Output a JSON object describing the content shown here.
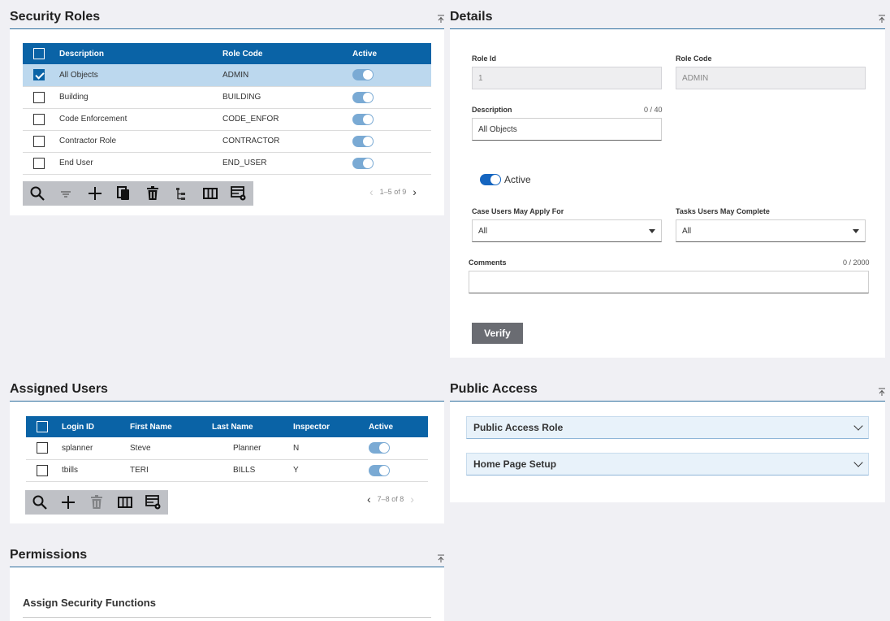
{
  "security_roles": {
    "title": "Security Roles",
    "columns": [
      "Description",
      "Role Code",
      "Active"
    ],
    "rows": [
      {
        "description": "All Objects",
        "code": "ADMIN",
        "selected": true
      },
      {
        "description": "Building",
        "code": "BUILDING",
        "selected": false
      },
      {
        "description": "Code Enforcement",
        "code": "CODE_ENFOR",
        "selected": false
      },
      {
        "description": "Contractor Role",
        "code": "CONTRACTOR",
        "selected": false
      },
      {
        "description": "End User",
        "code": "END_USER",
        "selected": false
      }
    ],
    "pager": "1–5 of 9"
  },
  "details": {
    "title": "Details",
    "role_id_label": "Role Id",
    "role_id_value": "1",
    "role_code_label": "Role Code",
    "role_code_value": "ADMIN",
    "description_label": "Description",
    "description_counter": "0 / 40",
    "description_value": "All Objects",
    "active_label": "Active",
    "case_users_label": "Case Users May Apply For",
    "case_users_value": "All",
    "tasks_users_label": "Tasks Users May Complete",
    "tasks_users_value": "All",
    "comments_label": "Comments",
    "comments_counter": "0 / 2000",
    "comments_value": "",
    "verify_label": "Verify"
  },
  "assigned_users": {
    "title": "Assigned Users",
    "columns": [
      "Login ID",
      "First Name",
      "Last Name",
      "Inspector",
      "Active"
    ],
    "rows": [
      {
        "login": "splanner",
        "first": "Steve",
        "last": "Planner",
        "inspector": "N"
      },
      {
        "login": "tbills",
        "first": "TERI",
        "last": "BILLS",
        "inspector": "Y"
      }
    ],
    "pager": "7–8 of 8"
  },
  "public_access": {
    "title": "Public Access",
    "sections": [
      "Public Access Role",
      "Home Page Setup"
    ]
  },
  "permissions": {
    "title": "Permissions",
    "subtitle": "Assign Security Functions"
  },
  "colors": {
    "accent": "#0a63a6",
    "toolbar": "#bfc1c6"
  }
}
